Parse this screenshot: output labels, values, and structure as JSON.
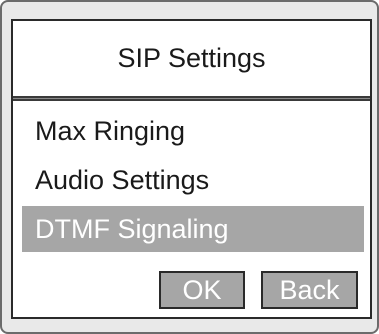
{
  "screen": {
    "title": "SIP Settings"
  },
  "menu": {
    "items": [
      {
        "label": "Max Ringing"
      },
      {
        "label": "Audio Settings"
      },
      {
        "label": "DTMF Signaling"
      }
    ],
    "selected_index": 2
  },
  "softkeys": {
    "ok_label": "OK",
    "back_label": "Back"
  },
  "colors": {
    "highlight": "#a6a6a6",
    "frame": "#e9e9e9",
    "text": "#1a1a1a"
  }
}
